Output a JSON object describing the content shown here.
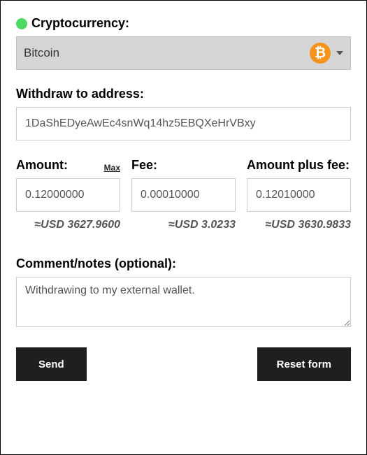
{
  "crypto": {
    "label": "Cryptocurrency:",
    "selected": "Bitcoin",
    "icon_symbol": "₿"
  },
  "address": {
    "label": "Withdraw to address:",
    "value": "1DaShEDyeAwEc4snWq14hz5EBQXeHrVBxy"
  },
  "amount": {
    "label": "Amount:",
    "value": "0.12000000",
    "max_label": "Max",
    "usd": "≈USD 3627.9600"
  },
  "fee": {
    "label": "Fee:",
    "value": "0.00010000",
    "usd": "≈USD 3.0233"
  },
  "amount_plus_fee": {
    "label": "Amount plus fee:",
    "value": "0.12010000",
    "usd": "≈USD 3630.9833"
  },
  "comment": {
    "label": "Comment/notes (optional):",
    "value": "Withdrawing to my external wallet."
  },
  "buttons": {
    "send": "Send",
    "reset": "Reset form"
  }
}
